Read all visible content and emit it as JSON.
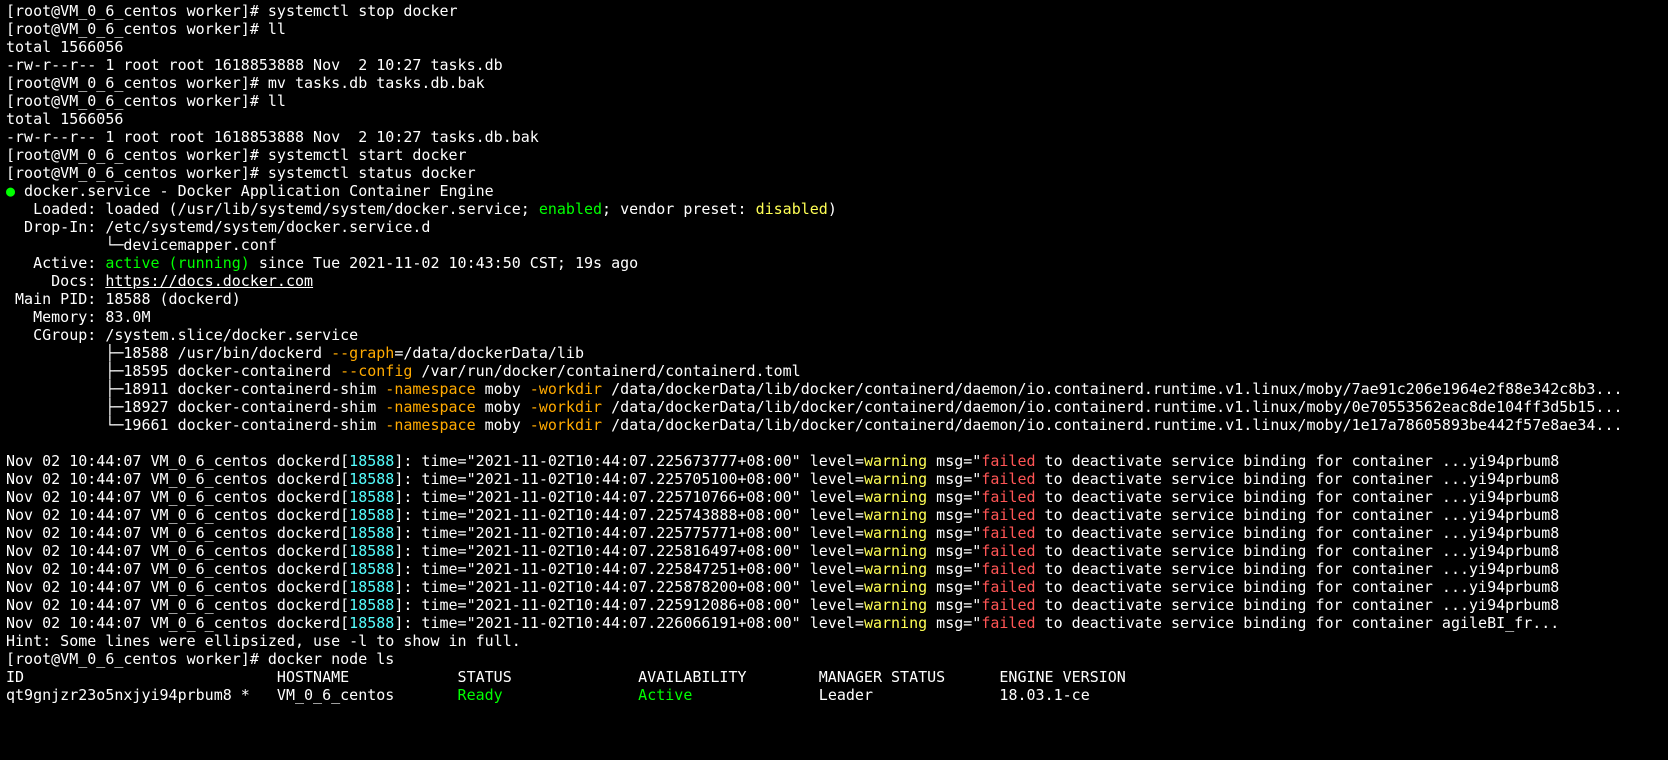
{
  "host": "VM_0_6_centos",
  "dir": "worker",
  "user": "root",
  "cmds": {
    "stop": "systemctl stop docker",
    "ll": "ll",
    "mv": "mv tasks.db tasks.db.bak",
    "start": "systemctl start docker",
    "status": "systemctl status docker",
    "nodels": "docker node ls"
  },
  "ls": {
    "total": "total 1566056",
    "row1": "-rw-r--r-- 1 root root 1618853888 Nov  2 10:27 tasks.db",
    "row2": "-rw-r--r-- 1 root root 1618853888 Nov  2 10:27 tasks.db.bak"
  },
  "svc": {
    "title": "docker.service - Docker Application Container Engine",
    "loaded_pref": "   Loaded: loaded (/usr/lib/systemd/system/docker.service; ",
    "enabled": "enabled",
    "loaded_mid": "; vendor preset: ",
    "disabled": "disabled",
    "loaded_suff": ")",
    "dropin1": "  Drop-In: /etc/systemd/system/docker.service.d",
    "dropin2": "           └─devicemapper.conf",
    "active_pref": "   Active: ",
    "active_val": "active (running)",
    "active_suff": " since Tue 2021-11-02 10:43:50 CST; 19s ago",
    "docs_pref": "     Docs: ",
    "docs_url": "https://docs.docker.com",
    "mainpid": " Main PID: 18588 (dockerd)",
    "memory": "   Memory: 83.0M",
    "cgroup": "   CGroup: /system.slice/docker.service"
  },
  "tree": {
    "p1": {
      "pre": "           ├─18588 /usr/bin/dockerd ",
      "flag": "--graph",
      "rest": "=/data/dockerData/lib"
    },
    "p2": {
      "pre": "           ├─18595 docker-containerd ",
      "flag": "--config",
      "rest": " /var/run/docker/containerd/containerd.toml"
    },
    "shim": {
      "pre1": "           ├─",
      "pre2": "           ├─",
      "pre3": "           └─",
      "pid1": "18911",
      "pid2": "18927",
      "pid3": "19661",
      "mid": " docker-containerd-shim ",
      "ns": "-namespace",
      "moby": " moby ",
      "wd": "-workdir",
      "r1": " /data/dockerData/lib/docker/containerd/daemon/io.containerd.runtime.v1.linux/moby/7ae91c206e1964e2f88e342c8b3...",
      "r2": " /data/dockerData/lib/docker/containerd/daemon/io.containerd.runtime.v1.linux/moby/0e70553562eac8de104ff3d5b15...",
      "r3": " /data/dockerData/lib/docker/containerd/daemon/io.containerd.runtime.v1.linux/moby/1e17a78605893be442f57e8ae34..."
    }
  },
  "log": {
    "pre": "Nov 02 10:44:07 VM_0_6_centos dockerd[",
    "pid": "18588",
    "midA": "]: time=\"2021-11-02T10:44:07.",
    "midB": "+08:00\" level=",
    "warn": "warning",
    "msg1": " msg=\"",
    "failed": "failed",
    "tail_yi": " to deactivate service binding for container ...yi94prbum8",
    "tail_ag": " to deactivate service binding for container agileBI_fr...",
    "ts": [
      "225673777",
      "225705100",
      "225710766",
      "225743888",
      "225775771",
      "225816497",
      "225847251",
      "225878200",
      "225912086",
      "226066191"
    ]
  },
  "hint": "Hint: Some lines were ellipsized, use -l to show in full.",
  "node": {
    "hdr_id": "ID",
    "hdr_host": "HOSTNAME",
    "hdr_status": "STATUS",
    "hdr_avail": "AVAILABILITY",
    "hdr_mgr": "MANAGER STATUS",
    "hdr_eng": "ENGINE VERSION",
    "id": "qt9gnjzr23o5nxjyi94prbum8 *",
    "host": "VM_0_6_centos",
    "status": "Ready",
    "avail": "Active",
    "mgr": "Leader",
    "eng": "18.03.1-ce"
  },
  "pad": {
    "id": "                            ",
    "host": "                    ",
    "status": "                   ",
    "avail": "                    ",
    "mgr": "                    "
  }
}
